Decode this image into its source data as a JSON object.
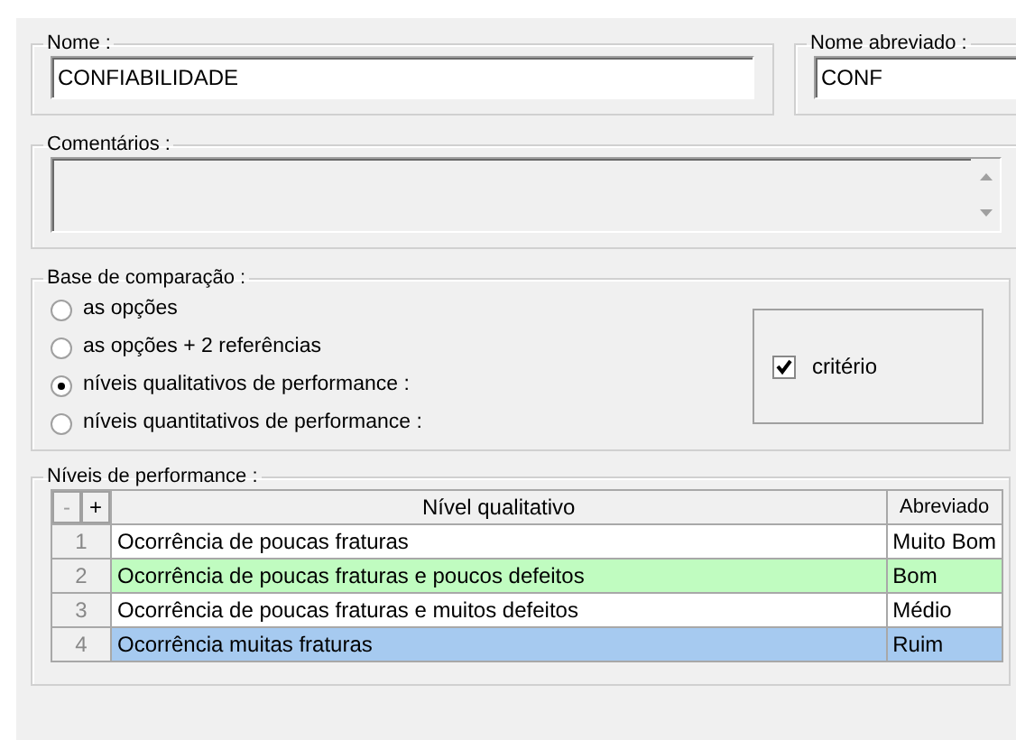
{
  "name_field": {
    "label": "Nome :",
    "value": "CONFIABILIDADE"
  },
  "short_name_field": {
    "label": "Nome abreviado :",
    "value": "CONF"
  },
  "comments": {
    "label": "Comentários :",
    "disabled": true
  },
  "comparison_base": {
    "label": "Base de comparação :",
    "options": [
      {
        "label": "as opções",
        "selected": false
      },
      {
        "label": "as opções + 2 referências",
        "selected": false
      },
      {
        "label": "níveis qualitativos de performance :",
        "selected": true
      },
      {
        "label": "níveis quantitativos de performance :",
        "selected": false
      }
    ],
    "criterion": {
      "label": "critério",
      "checked": true
    }
  },
  "performance_levels": {
    "label": "Níveis de performance :",
    "remove_button": {
      "label": "-",
      "disabled": true
    },
    "add_button": {
      "label": "+",
      "disabled": false
    },
    "columns": [
      "Nível qualitativo",
      "Abreviado"
    ],
    "rows": [
      {
        "number": "1",
        "description": "Ocorrência de poucas fraturas",
        "abbreviation": "Muito Bom",
        "color": "#ffffff"
      },
      {
        "number": "2",
        "description": "Ocorrência de poucas fraturas e poucos defeitos",
        "abbreviation": "Bom",
        "color": "#c0fcc0"
      },
      {
        "number": "3",
        "description": "Ocorrência de poucas fraturas e muitos defeitos",
        "abbreviation": "Médio",
        "color": "#ffffff"
      },
      {
        "number": "4",
        "description": "Ocorrência muitas fraturas",
        "abbreviation": "Ruim",
        "color": "#a6caf0"
      }
    ]
  }
}
